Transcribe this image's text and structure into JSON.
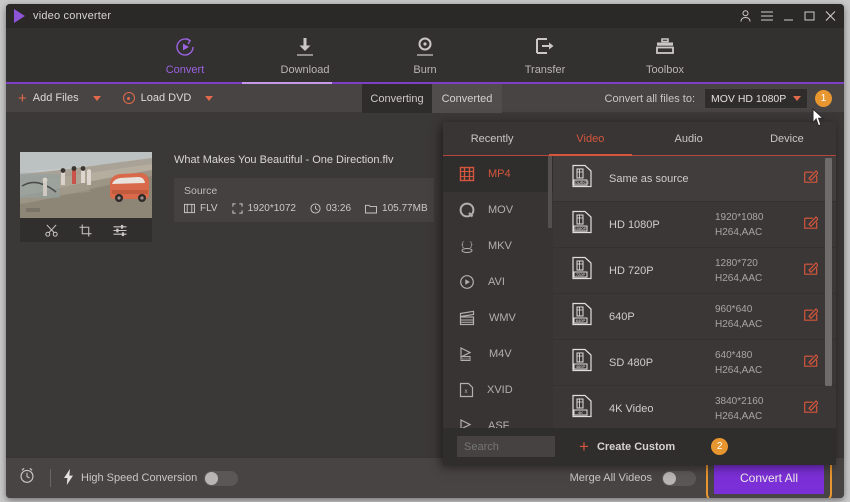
{
  "window": {
    "title": "video converter",
    "controls": [
      "account-icon",
      "menu-icon",
      "minimize",
      "maximize",
      "close"
    ]
  },
  "nav": {
    "items": [
      {
        "label": "Convert",
        "icon": "convert-icon",
        "active": true
      },
      {
        "label": "Download",
        "icon": "download-icon",
        "active": false
      },
      {
        "label": "Burn",
        "icon": "burn-icon",
        "active": false
      },
      {
        "label": "Transfer",
        "icon": "transfer-icon",
        "active": false
      },
      {
        "label": "Toolbox",
        "icon": "toolbox-icon",
        "active": false
      }
    ]
  },
  "toolbar": {
    "add_files": "Add Files",
    "load_dvd": "Load DVD",
    "tabs": [
      {
        "label": "Converting",
        "active": true
      },
      {
        "label": "Converted",
        "active": false
      }
    ],
    "convert_all_label": "Convert all files to:",
    "convert_all_value": "MOV HD 1080P",
    "badge": "1"
  },
  "file": {
    "name": "What Makes You Beautiful - One Direction.flv",
    "source_label": "Source",
    "format": "FLV",
    "resolution": "1920*1072",
    "duration": "03:26",
    "size": "105.77MB",
    "tools": [
      "trim-icon",
      "crop-icon",
      "effect-icon"
    ]
  },
  "panel": {
    "tabs": [
      {
        "label": "Recently",
        "active": false
      },
      {
        "label": "Video",
        "active": true
      },
      {
        "label": "Audio",
        "active": false
      },
      {
        "label": "Device",
        "active": false
      }
    ],
    "formats": [
      {
        "label": "MP4",
        "icon": "mp4-icon",
        "active": true
      },
      {
        "label": "MOV",
        "icon": "mov-icon",
        "active": false
      },
      {
        "label": "MKV",
        "icon": "mkv-icon",
        "active": false
      },
      {
        "label": "AVI",
        "icon": "avi-icon",
        "active": false
      },
      {
        "label": "WMV",
        "icon": "wmv-icon",
        "active": false
      },
      {
        "label": "M4V",
        "icon": "m4v-icon",
        "active": false
      },
      {
        "label": "XVID",
        "icon": "xvid-icon",
        "active": false
      },
      {
        "label": "ASF",
        "icon": "asf-icon",
        "active": false
      }
    ],
    "presets": [
      {
        "name": "Same as source",
        "badge": "SOURCE",
        "resolution": "",
        "codec": ""
      },
      {
        "name": "HD 1080P",
        "badge": "1080P",
        "resolution": "1920*1080",
        "codec": "H264,AAC"
      },
      {
        "name": "HD 720P",
        "badge": "720P",
        "resolution": "1280*720",
        "codec": "H264,AAC"
      },
      {
        "name": "640P",
        "badge": "640P",
        "resolution": "960*640",
        "codec": "H264,AAC"
      },
      {
        "name": "SD 480P",
        "badge": "480P",
        "resolution": "640*480",
        "codec": "H264,AAC"
      },
      {
        "name": "4K Video",
        "badge": "4K",
        "resolution": "3840*2160",
        "codec": "H264,AAC"
      }
    ],
    "search_placeholder": "Search",
    "create_custom": "Create Custom",
    "badge": "2"
  },
  "bottom": {
    "timer_icon": "alarm-clock-icon",
    "high_speed_label": "High Speed Conversion",
    "high_speed_on": false,
    "merge_label": "Merge All Videos",
    "merge_on": false,
    "convert_all_button": "Convert All"
  },
  "colors": {
    "accent_purple": "#7b2fd6",
    "accent_orange": "#e8962f",
    "accent_red": "#d4563c",
    "window_bg": "#3b3838"
  }
}
